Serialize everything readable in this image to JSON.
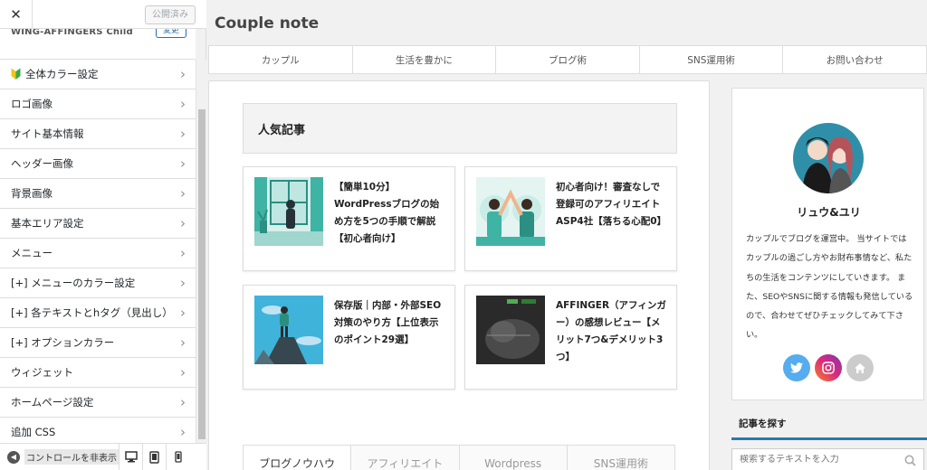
{
  "customizer": {
    "close_glyph": "✕",
    "publish_label": "公開済み",
    "theme_name": "WING-AFFINGERS Child",
    "change_label": "変更",
    "chevron": "›",
    "menu_items": [
      {
        "label": "全体カラー設定",
        "icon": "beginner-leaf-icon"
      },
      {
        "label": "ロゴ画像"
      },
      {
        "label": "サイト基本情報"
      },
      {
        "label": "ヘッダー画像"
      },
      {
        "label": "背景画像"
      },
      {
        "label": "基本エリア設定"
      },
      {
        "label": "メニュー"
      },
      {
        "label": "[+] メニューのカラー設定"
      },
      {
        "label": "[+] 各テキストとhタグ（見出し）"
      },
      {
        "label": "[+] オプションカラー"
      },
      {
        "label": "ウィジェット"
      },
      {
        "label": "ホームページ設定"
      },
      {
        "label": "追加 CSS"
      }
    ],
    "footer": {
      "collapse_label": "コントロールを非表示",
      "devices": [
        "desktop-icon",
        "tablet-icon",
        "mobile-icon"
      ]
    }
  },
  "preview": {
    "site_title": "Couple note",
    "nav": [
      "カップル",
      "生活を豊かに",
      "ブログ術",
      "SNS運用術",
      "お問い合わせ"
    ],
    "popular_heading": "人気記事",
    "posts": [
      {
        "title": "【簡単10分】WordPressブログの始め方を5つの手順で解説【初心者向け】",
        "thumb": "window-plant-illustration"
      },
      {
        "title": "初心者向け！審査なしで登録可のアフィリエイトASP4社【落ちる心配0】",
        "thumb": "high-five-illustration"
      },
      {
        "title": "保存版｜内部・外部SEO対策のやり方【上位表示のポイント29選】",
        "thumb": "mountain-summit-illustration"
      },
      {
        "title": "AFFINGER（アフィンガー）の感想レビュー【メリット7つ&デメリット3つ】",
        "thumb": "dark-photo-thumbnail"
      }
    ],
    "tabs": [
      "ブログノウハウ",
      "アフィリエイト",
      "Wordpress",
      "SNS運用術"
    ],
    "profile": {
      "name": "リュウ&ユリ",
      "bio": "カップルでブログを運営中。 当サイトではカップルの過ごし方やお財布事情など、私たちの生活をコンテンツにしていきます。 また、SEOやSNSに関する情報も発信しているので、合わせてぜひチェックしてみて下さい。",
      "social": [
        {
          "icon": "twitter-icon",
          "color": "#55acee"
        },
        {
          "icon": "instagram-icon",
          "color": "#d6249f"
        },
        {
          "icon": "home-icon",
          "color": "#cccccc"
        }
      ]
    },
    "search": {
      "heading": "記事を探す",
      "placeholder": "検索するテキストを入力"
    }
  }
}
